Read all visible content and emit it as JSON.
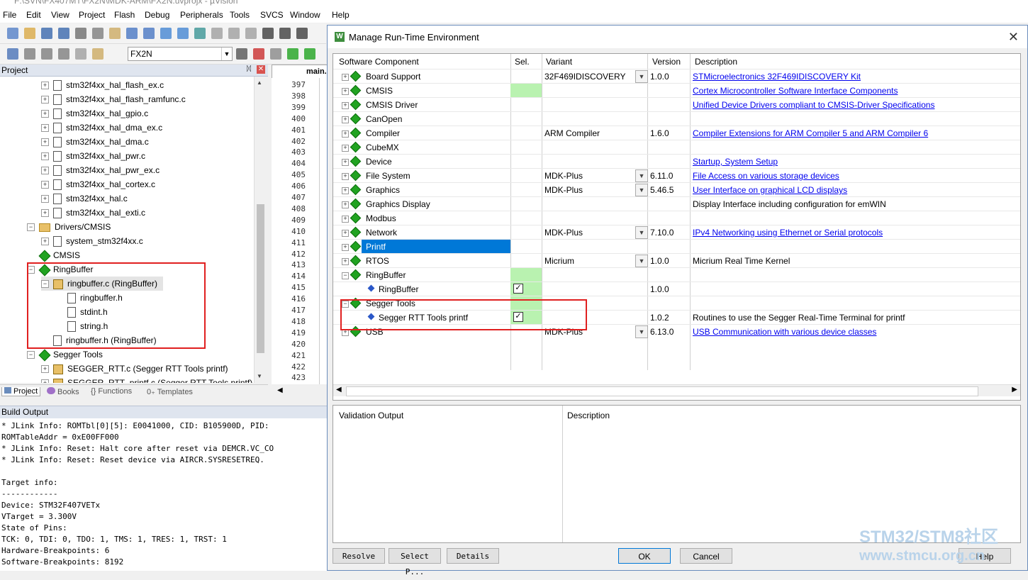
{
  "window": {
    "title": "F:\\SVN\\FX407MT\\FX2N\\MDK-ARM\\FX2N.uvprojx - µVision"
  },
  "menu": [
    "File",
    "Edit",
    "View",
    "Project",
    "Flash",
    "Debug",
    "Peripherals",
    "Tools",
    "SVCS",
    "Window",
    "Help"
  ],
  "toolbar": {
    "target": "FX2N"
  },
  "project_panel": {
    "title": "Project",
    "tree": [
      {
        "label": "stm32f4xx_hal_flash_ex.c",
        "indent": 3,
        "icon": "file-icon",
        "expander": "+"
      },
      {
        "label": "stm32f4xx_hal_flash_ramfunc.c",
        "indent": 3,
        "icon": "file-icon",
        "expander": "+"
      },
      {
        "label": "stm32f4xx_hal_gpio.c",
        "indent": 3,
        "icon": "file-icon",
        "expander": "+"
      },
      {
        "label": "stm32f4xx_hal_dma_ex.c",
        "indent": 3,
        "icon": "file-icon",
        "expander": "+"
      },
      {
        "label": "stm32f4xx_hal_dma.c",
        "indent": 3,
        "icon": "file-icon",
        "expander": "+"
      },
      {
        "label": "stm32f4xx_hal_pwr.c",
        "indent": 3,
        "icon": "file-icon",
        "expander": "+"
      },
      {
        "label": "stm32f4xx_hal_pwr_ex.c",
        "indent": 3,
        "icon": "file-icon",
        "expander": "+"
      },
      {
        "label": "stm32f4xx_hal_cortex.c",
        "indent": 3,
        "icon": "file-icon",
        "expander": "+"
      },
      {
        "label": "stm32f4xx_hal.c",
        "indent": 3,
        "icon": "file-icon",
        "expander": "+"
      },
      {
        "label": "stm32f4xx_hal_exti.c",
        "indent": 3,
        "icon": "file-icon",
        "expander": "+"
      },
      {
        "label": "Drivers/CMSIS",
        "indent": 2,
        "icon": "folder-icon",
        "expander": "-"
      },
      {
        "label": "system_stm32f4xx.c",
        "indent": 3,
        "icon": "file-icon",
        "expander": "+"
      },
      {
        "label": "CMSIS",
        "indent": 2,
        "icon": "component-diamond-icon",
        "expander": ""
      },
      {
        "label": "RingBuffer",
        "indent": 2,
        "icon": "component-diamond-icon",
        "expander": "-"
      },
      {
        "label": "ringbuffer.c (RingBuffer)",
        "indent": 3,
        "icon": "key-file-icon",
        "expander": "-",
        "selected": true
      },
      {
        "label": "ringbuffer.h",
        "indent": 4,
        "icon": "file-icon",
        "expander": ""
      },
      {
        "label": "stdint.h",
        "indent": 4,
        "icon": "file-icon",
        "expander": ""
      },
      {
        "label": "string.h",
        "indent": 4,
        "icon": "file-icon",
        "expander": ""
      },
      {
        "label": "ringbuffer.h (RingBuffer)",
        "indent": 3,
        "icon": "file-icon",
        "expander": ""
      },
      {
        "label": "Segger Tools",
        "indent": 2,
        "icon": "component-diamond-icon",
        "expander": "-"
      },
      {
        "label": "SEGGER_RTT.c (Segger RTT Tools printf)",
        "indent": 3,
        "icon": "key-file-icon",
        "expander": "+"
      },
      {
        "label": "SEGGER_RTT_printf.c (Segger RTT Tools printf)",
        "indent": 3,
        "icon": "key-file-icon",
        "expander": "+"
      }
    ],
    "tabs": [
      "Project",
      "Books",
      "Functions",
      "Templates"
    ]
  },
  "editor": {
    "tab": "main.c",
    "line_numbers": [
      "397",
      "398",
      "399",
      "400",
      "401",
      "402",
      "403",
      "404",
      "405",
      "406",
      "407",
      "408",
      "409",
      "410",
      "411",
      "412",
      "413",
      "414",
      "415",
      "416",
      "417",
      "418",
      "419",
      "420",
      "421",
      "422",
      "423"
    ]
  },
  "build_output": {
    "title": "Build Output",
    "lines": [
      "* JLink Info: ROMTbl[0][5]: E0041000, CID: B105900D, PID:",
      "ROMTableAddr = 0xE00FF000",
      "* JLink Info: Reset: Halt core after reset via DEMCR.VC_CO",
      "* JLink Info: Reset: Reset device via AIRCR.SYSRESETREQ.",
      "",
      "Target info:",
      "------------",
      "Device: STM32F407VETx",
      "VTarget = 3.300V",
      "State of Pins:",
      "TCK: 0, TDI: 0, TDO: 1, TMS: 1, TRES: 1, TRST: 1",
      "Hardware-Breakpoints: 6",
      "Software-Breakpoints: 8192"
    ]
  },
  "dialog": {
    "title": "Manage Run-Time Environment",
    "columns": [
      "Software Component",
      "Sel.",
      "Variant",
      "Version",
      "Description"
    ],
    "rows": [
      {
        "name": "Board Support",
        "level": 0,
        "expander": "+",
        "icon": "diamond",
        "sel": "",
        "variant": "32F469IDISCOVERY",
        "dropdown": true,
        "version": "1.0.0",
        "desc": "STMicroelectronics 32F469IDISCOVERY Kit",
        "link": true
      },
      {
        "name": "CMSIS",
        "level": 0,
        "expander": "+",
        "icon": "diamond",
        "sel": "green",
        "variant": "",
        "dropdown": false,
        "version": "",
        "desc": "Cortex Microcontroller Software Interface Components",
        "link": true
      },
      {
        "name": "CMSIS Driver",
        "level": 0,
        "expander": "+",
        "icon": "diamond",
        "sel": "",
        "variant": "",
        "dropdown": false,
        "version": "",
        "desc": "Unified Device Drivers compliant to CMSIS-Driver Specifications",
        "link": true
      },
      {
        "name": "CanOpen",
        "level": 0,
        "expander": "+",
        "icon": "diamond",
        "sel": "",
        "variant": "",
        "dropdown": false,
        "version": "",
        "desc": "",
        "link": false
      },
      {
        "name": "Compiler",
        "level": 0,
        "expander": "+",
        "icon": "diamond",
        "sel": "",
        "variant": "ARM Compiler",
        "dropdown": false,
        "version": "1.6.0",
        "desc": "Compiler Extensions for ARM Compiler 5 and ARM Compiler 6",
        "link": true
      },
      {
        "name": "CubeMX",
        "level": 0,
        "expander": "+",
        "icon": "diamond",
        "sel": "",
        "variant": "",
        "dropdown": false,
        "version": "",
        "desc": "",
        "link": false
      },
      {
        "name": "Device",
        "level": 0,
        "expander": "+",
        "icon": "diamond",
        "sel": "",
        "variant": "",
        "dropdown": false,
        "version": "",
        "desc": "Startup, System Setup",
        "link": true
      },
      {
        "name": "File System",
        "level": 0,
        "expander": "+",
        "icon": "diamond",
        "sel": "",
        "variant": "MDK-Plus",
        "dropdown": true,
        "version": "6.11.0",
        "desc": "File Access on various storage devices",
        "link": true
      },
      {
        "name": "Graphics",
        "level": 0,
        "expander": "+",
        "icon": "diamond",
        "sel": "",
        "variant": "MDK-Plus",
        "dropdown": true,
        "version": "5.46.5",
        "desc": "User Interface on graphical LCD displays",
        "link": true
      },
      {
        "name": "Graphics Display",
        "level": 0,
        "expander": "+",
        "icon": "diamond",
        "sel": "",
        "variant": "",
        "dropdown": false,
        "version": "",
        "desc": "Display Interface including configuration for emWIN",
        "link": false
      },
      {
        "name": "Modbus",
        "level": 0,
        "expander": "+",
        "icon": "diamond",
        "sel": "",
        "variant": "",
        "dropdown": false,
        "version": "",
        "desc": "",
        "link": false
      },
      {
        "name": "Network",
        "level": 0,
        "expander": "+",
        "icon": "diamond",
        "sel": "",
        "variant": "MDK-Plus",
        "dropdown": true,
        "version": "7.10.0",
        "desc": "IPv4 Networking using Ethernet or Serial protocols",
        "link": true
      },
      {
        "name": "Printf",
        "level": 0,
        "expander": "+",
        "icon": "diamond",
        "sel": "",
        "variant": "",
        "dropdown": false,
        "version": "",
        "desc": "",
        "link": false,
        "highlight": true
      },
      {
        "name": "RTOS",
        "level": 0,
        "expander": "+",
        "icon": "diamond",
        "sel": "",
        "variant": "Micrium",
        "dropdown": true,
        "version": "1.0.0",
        "desc": "Micrium Real Time Kernel",
        "link": false
      },
      {
        "name": "RingBuffer",
        "level": 0,
        "expander": "-",
        "icon": "diamond",
        "sel": "green",
        "variant": "",
        "dropdown": false,
        "version": "",
        "desc": "",
        "link": false
      },
      {
        "name": "RingBuffer",
        "level": 1,
        "expander": "",
        "icon": "blue",
        "sel": "check",
        "variant": "",
        "dropdown": false,
        "version": "1.0.0",
        "desc": "",
        "link": false
      },
      {
        "name": "Segger Tools",
        "level": 0,
        "expander": "-",
        "icon": "diamond",
        "sel": "green",
        "variant": "",
        "dropdown": false,
        "version": "",
        "desc": "",
        "link": false
      },
      {
        "name": "Segger RTT Tools printf",
        "level": 1,
        "expander": "",
        "icon": "blue",
        "sel": "check",
        "variant": "",
        "dropdown": false,
        "version": "1.0.2",
        "desc": "Routines to use the Segger Real-Time Terminal for printf",
        "link": false
      },
      {
        "name": "USB",
        "level": 0,
        "expander": "+",
        "icon": "diamond",
        "sel": "",
        "variant": "MDK-Plus",
        "dropdown": true,
        "version": "6.13.0",
        "desc": "USB Communication with various device classes",
        "link": true
      }
    ],
    "validation": {
      "col1": "Validation Output",
      "col2": "Description"
    },
    "buttons": {
      "resolve": "Resolve",
      "select": "Select P...",
      "details": "Details",
      "ok": "OK",
      "cancel": "Cancel",
      "help": "Help"
    }
  },
  "watermark": {
    "line1": "STM32/STM8社区",
    "line2": "www.stmcu.org.cn"
  },
  "colors": {
    "highlight": "#0078d7",
    "selection_green": "#b9f2b0",
    "link": "#0000ee",
    "annotation_red": "#e02020"
  }
}
